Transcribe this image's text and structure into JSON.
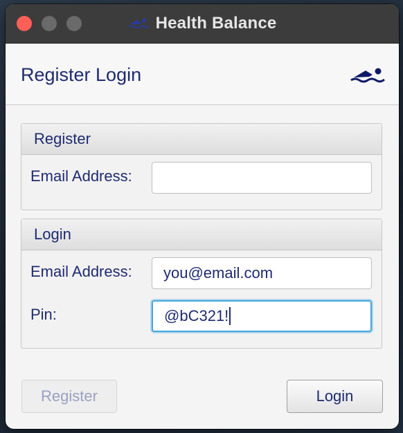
{
  "window": {
    "title": "Health Balance",
    "icon": "swimmer-icon"
  },
  "header": {
    "title": "Register Login",
    "icon": "swimmer-icon"
  },
  "register_panel": {
    "heading": "Register",
    "email_label": "Email Address:",
    "email_value": ""
  },
  "login_panel": {
    "heading": "Login",
    "email_label": "Email Address:",
    "email_value": "you@email.com",
    "pin_label": "Pin:",
    "pin_value": "@bC321!"
  },
  "buttons": {
    "register": "Register",
    "register_enabled": false,
    "login": "Login"
  },
  "colors": {
    "accent_text": "#1f2a70",
    "focus_ring": "#44a6dc",
    "close_button": "#fe5f57"
  }
}
